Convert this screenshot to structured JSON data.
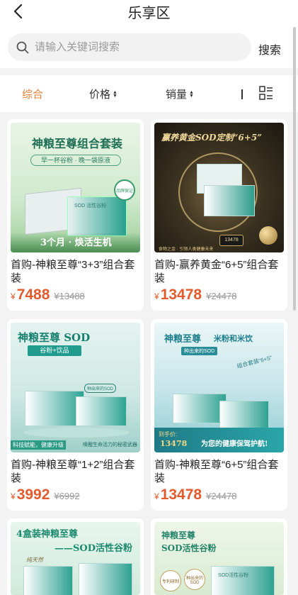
{
  "header": {
    "title": "乐享区"
  },
  "search": {
    "placeholder": "请输入关键词搜索",
    "button": "搜索"
  },
  "sort": {
    "comprehensive": "综合",
    "price": "价格",
    "sales": "销量"
  },
  "products": [
    {
      "name": "首购-神粮至尊“3+3”组合套装",
      "currency": "¥",
      "price": "7488",
      "original_price": "¥13488",
      "image_text": {
        "headline": "神粮至尊组合套装",
        "subline": "早一杯谷粉 · 晚一袋原液",
        "bottom": "3个月 · 焕活生机",
        "box_label": "SOD 活性谷粉",
        "badge": "品牌保证"
      }
    },
    {
      "name": "首购-赢养黄金“6+5”组合套装",
      "currency": "¥",
      "price": "13478",
      "original_price": "¥24478",
      "image_text": {
        "headline": "赢养黄金SOD定制“6+5”",
        "footer": "食物之金 · 引领人类健康未来",
        "price_tag": "13478"
      }
    },
    {
      "name": "首购-神粮至尊“1+2”组合套装",
      "currency": "¥",
      "price": "3992",
      "original_price": "¥6992",
      "image_text": {
        "headline": "神粮至尊 SOD",
        "chip": "谷粉+饮品",
        "tag": "种出来的SOD",
        "left": "科技赋能，健康升级",
        "right": "唤醒生命活力的秘密武器"
      }
    },
    {
      "name": "首购-神粮至尊“6+5”组合套装",
      "currency": "¥",
      "price": "13478",
      "original_price": "¥24478",
      "image_text": {
        "headline": "神粮至尊",
        "headline2": "米粉和米饮",
        "sub": "种出来的SOD",
        "corner": "组合套装“6+5”",
        "price_label": "到手价:",
        "price_value": "13478",
        "slogan": "为您的健康保驾护航!"
      }
    },
    {
      "name": "",
      "image_text": {
        "headline": "4盒装神粮至尊",
        "sub": "——SOD活性谷粉",
        "box_side": "纯天然"
      }
    },
    {
      "name": "",
      "image_text": {
        "headline": "神粮至尊",
        "sub": "SOD活性谷粉",
        "badge": "专利研制",
        "badge2": "种出来的SOD",
        "box_label": "SOD活性谷粉"
      }
    }
  ],
  "colors": {
    "accent": "#e8823a",
    "price": "#e35a2d",
    "teal": "#1f9c8e"
  }
}
